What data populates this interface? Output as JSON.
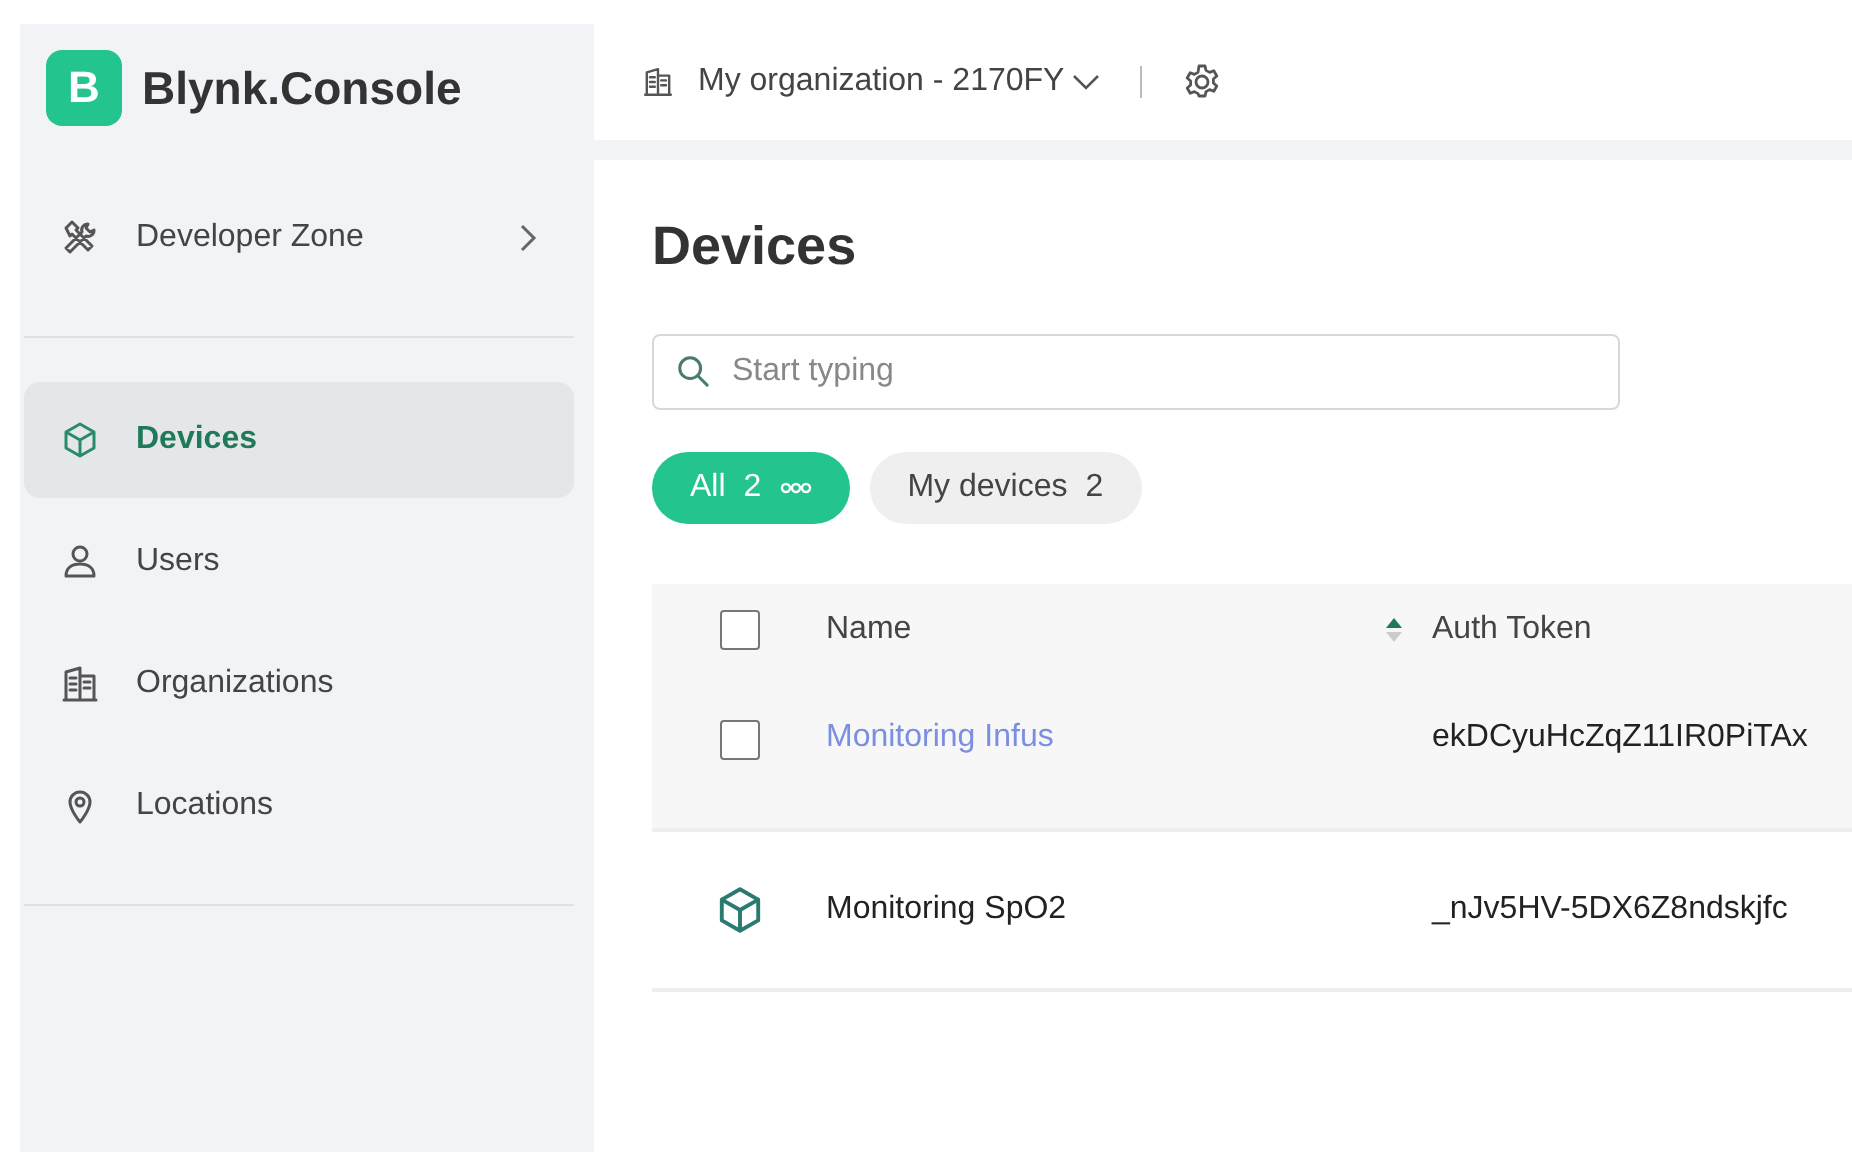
{
  "brand": {
    "logo_letter": "B",
    "name": "Blynk.Console"
  },
  "header": {
    "organization": "My organization - 2170FY"
  },
  "sidebar": {
    "top_items": [
      {
        "label": "Developer Zone",
        "kind": "tools",
        "expandable": true
      }
    ],
    "items": [
      {
        "label": "Devices",
        "kind": "cube",
        "selected": true
      },
      {
        "label": "Users",
        "kind": "user",
        "selected": false
      },
      {
        "label": "Organizations",
        "kind": "building",
        "selected": false
      },
      {
        "label": "Locations",
        "kind": "pin",
        "selected": false
      }
    ]
  },
  "page": {
    "title": "Devices"
  },
  "search": {
    "placeholder": "Start typing"
  },
  "filters": [
    {
      "label": "All",
      "count": "2",
      "selected": true,
      "has_menu": true
    },
    {
      "label": "My devices",
      "count": "2",
      "selected": false,
      "has_menu": false
    }
  ],
  "table": {
    "select_all_checked": false,
    "columns": [
      {
        "label": "Name",
        "sorted": true
      },
      {
        "label": "Auth Token",
        "sorted": false
      }
    ],
    "rows": [
      {
        "name": "Monitoring Infus",
        "token": "ekDCyuHcZqZ11IR0PiTAx",
        "hovered": true,
        "checked": false
      },
      {
        "name": "Monitoring SpO2",
        "token": "_nJv5HV-5DX6Z8ndskjfc",
        "hovered": false
      }
    ]
  }
}
